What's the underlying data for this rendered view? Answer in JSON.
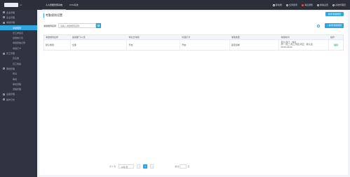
{
  "topbar": {
    "logo_sub": "ptf",
    "tabs": [
      {
        "label": "人人智能管家系统"
      },
      {
        "label": "PCM系统"
      }
    ],
    "right_items": [
      {
        "label": "移动端"
      },
      {
        "label": "全局搜索"
      },
      {
        "label": "消息通知"
      },
      {
        "label": "换肤设置"
      },
      {
        "label": "系统管理员"
      }
    ]
  },
  "sidebar": {
    "items": [
      {
        "label": "企业管理",
        "type": "group"
      },
      {
        "label": "企业管理",
        "type": "group"
      },
      {
        "label": "考勤管理",
        "type": "group"
      },
      {
        "label": "考勤规则",
        "type": "sub",
        "active": true
      },
      {
        "label": "员工排班表",
        "type": "sub"
      },
      {
        "label": "出勤统计表",
        "type": "sub"
      },
      {
        "label": "考勤原始记录",
        "type": "sub"
      },
      {
        "label": "考勤打卡",
        "type": "sub"
      },
      {
        "label": "员工管理",
        "type": "group"
      },
      {
        "label": "花名册",
        "type": "sub"
      },
      {
        "label": "员工档案",
        "type": "sub"
      },
      {
        "label": "审批管理",
        "type": "group"
      },
      {
        "label": "申请",
        "type": "sub"
      },
      {
        "label": "审批",
        "type": "sub"
      },
      {
        "label": "审批流程",
        "type": "sub"
      },
      {
        "label": "流程管理",
        "type": "sub"
      },
      {
        "label": "设备管理",
        "type": "group"
      },
      {
        "label": "操作日志",
        "type": "group"
      }
    ]
  },
  "main": {
    "title": "考勤规则设置",
    "top_button": "新增考勤规则",
    "search": {
      "label": "考勤规则名称",
      "placeholder": "请输入考勤规则名称"
    },
    "add_button": "+ 新增考勤规则",
    "table": {
      "headers": [
        "考勤规则名称",
        "适用部门/人员",
        "休息日考勤",
        "外勤打卡",
        "考勤类型",
        "考勤时间",
        "操作"
      ],
      "rows": [
        {
          "name": "默认规则",
          "scope": "全部",
          "rest": "开启",
          "field": "开启",
          "type": "固定班制",
          "time_lines": [
            "周六,周日：休息",
            "周一,周二,周三,周四,周五：默认班",
            "09:00-18:00"
          ],
          "op": "编辑"
        }
      ]
    },
    "pagination": {
      "total": "共 1 条",
      "page_size": "10条/页",
      "prev": "<",
      "current": "1",
      "next": ">",
      "goto_label": "前往",
      "goto_suffix": "页"
    }
  },
  "colors": {
    "accent": "#2da6e2",
    "sidebar_bg": "#2f3440",
    "topbar_bg": "#2b2f3a"
  }
}
